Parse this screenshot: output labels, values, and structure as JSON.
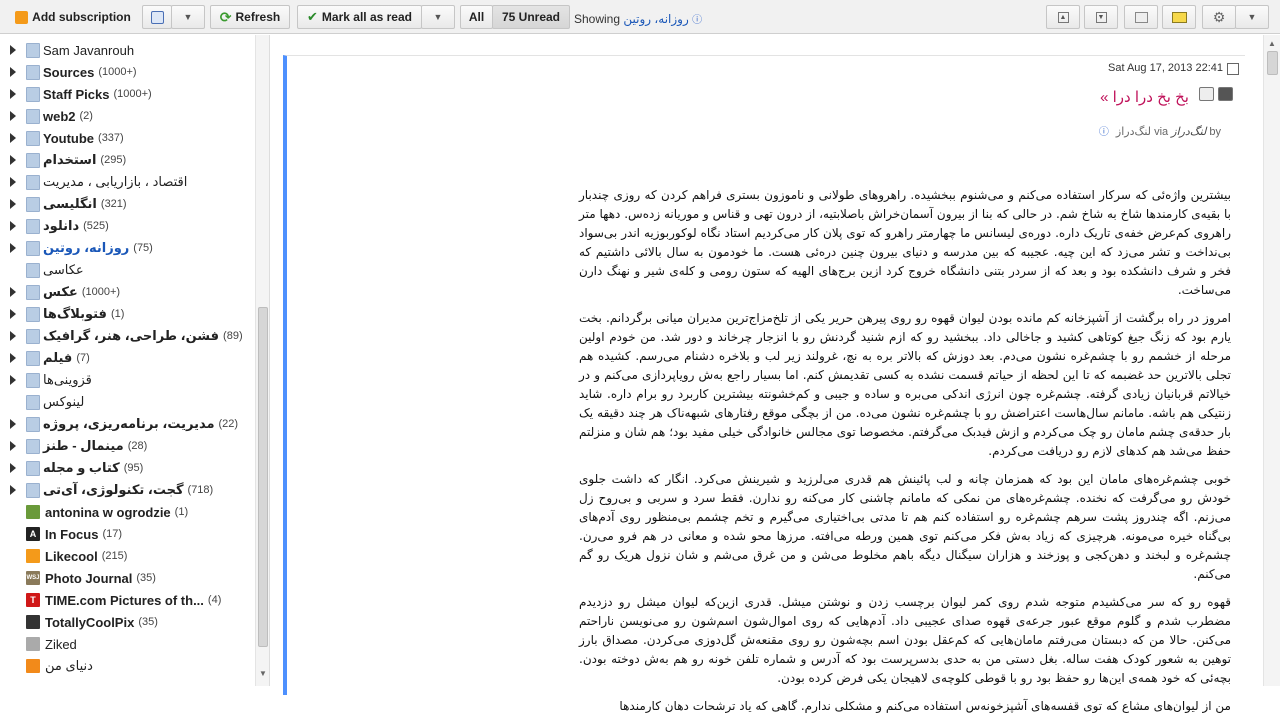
{
  "toolbar": {
    "add_subscription": "Add subscription",
    "refresh": "Refresh",
    "mark_all_read": "Mark all as read",
    "all": "All",
    "unread": "75 Unread",
    "showing": "Showing",
    "showing_feed": "روزانه، روتین",
    "colors": {
      "refresh_icon": "#3a9a2f",
      "check": "#2a8a2a",
      "rss": "#f49a1a"
    }
  },
  "sidebar": {
    "items": [
      {
        "label": "Sam Javanrouh",
        "count": "",
        "type": "folder",
        "bold": false
      },
      {
        "label": "Sources",
        "count": "(1000+)",
        "type": "folder",
        "bold": true
      },
      {
        "label": "Staff Picks",
        "count": "(1000+)",
        "type": "folder",
        "bold": true
      },
      {
        "label": "web2",
        "count": "(2)",
        "type": "folder",
        "bold": true
      },
      {
        "label": "Youtube",
        "count": "(337)",
        "type": "folder",
        "bold": true
      },
      {
        "label": "استخدام",
        "count": "(295)",
        "type": "folder",
        "bold": true
      },
      {
        "label": "اقتصاد ، بازاریابی ، مدیریت",
        "count": "",
        "type": "folder",
        "bold": false
      },
      {
        "label": "انگلیسی",
        "count": "(321)",
        "type": "folder",
        "bold": true
      },
      {
        "label": "دانلود",
        "count": "(525)",
        "type": "folder",
        "bold": true
      },
      {
        "label": "روزانه، روتین",
        "count": "(75)",
        "type": "folder",
        "bold": true,
        "selected": true
      },
      {
        "label": "عکاسی",
        "count": "",
        "type": "folder",
        "bold": false,
        "noarrow": true
      },
      {
        "label": "عکس",
        "count": "(1000+)",
        "type": "folder",
        "bold": true
      },
      {
        "label": "فتوبلاگ‌ها",
        "count": "(1)",
        "type": "folder",
        "bold": true
      },
      {
        "label": "فشن، طراحی، هنر، گرافیک",
        "count": "(89)",
        "type": "folder",
        "bold": true
      },
      {
        "label": "فیلم",
        "count": "(7)",
        "type": "folder",
        "bold": true
      },
      {
        "label": "قزوینی‌ها",
        "count": "",
        "type": "folder",
        "bold": false
      },
      {
        "label": "لینوکس",
        "count": "",
        "type": "folder",
        "bold": false,
        "noarrow": true
      },
      {
        "label": "مدیریت، برنامه‌ریزی، پروژه",
        "count": "(22)",
        "type": "folder",
        "bold": true
      },
      {
        "label": "مینمال - طنز",
        "count": "(28)",
        "type": "folder",
        "bold": true
      },
      {
        "label": "کتاب و مجله",
        "count": "(95)",
        "type": "folder",
        "bold": true
      },
      {
        "label": "گجت، تکنولوژی، آی‌تی",
        "count": "(718)",
        "type": "folder",
        "bold": true
      },
      {
        "label": "antonina w ogrodzie",
        "count": "(1)",
        "type": "feed",
        "bold": true,
        "icon_color": "#6a9a3a"
      },
      {
        "label": "In Focus",
        "count": "(17)",
        "type": "feed",
        "bold": true,
        "icon_color": "#222222",
        "icon_text": "A"
      },
      {
        "label": "Likecool",
        "count": "(215)",
        "type": "feed",
        "bold": true,
        "icon_color": "#f49a1a"
      },
      {
        "label": "Photo Journal",
        "count": "(35)",
        "type": "feed",
        "bold": true,
        "icon_color": "#8a7a5a",
        "icon_text": "WSJ"
      },
      {
        "label": "TIME.com Pictures of th...",
        "count": "(4)",
        "type": "feed",
        "bold": true,
        "icon_color": "#d01818",
        "icon_text": "T",
        "trunc": true
      },
      {
        "label": "TotallyCoolPix",
        "count": "(35)",
        "type": "feed",
        "bold": true,
        "icon_color": "#333333"
      },
      {
        "label": "Ziked",
        "count": "",
        "type": "feed",
        "bold": false,
        "icon_color": "#aaaaaa"
      },
      {
        "label": "دنیای من",
        "count": "",
        "type": "feed",
        "bold": false,
        "icon_color": "#f28a1a"
      }
    ]
  },
  "entry": {
    "date": "Sat Aug 17, 2013 22:41",
    "title": "بخ بخ درا درا »",
    "by": "by",
    "author": "لنگ‌دراز",
    "via": "via",
    "source": "لنگ‌دراز",
    "paragraphs": [
      "بیشترین واژه‌ئی که سرکار استفاده می‌کنم و می‌شنوم ببخشیده. راهروهای طولانی و ناموزون بستری فراهم کردن که روزی چندبار با بقیه‌ی کارمندها شاخ به شاخ شم. در حالی که بنا از بیرون آسمان‌خراش باصلابتیه، از درون تهی و قناس و موریانه زده‌س. دهها متر راهروی کم‌عرض خفه‌ی تاریک داره. دوره‌ی لیسانس ما چهارمتر راهرو که توی پلان کار می‌کردیم استاد نگاه لوکوربوزیه اندر بی‌سواد بی‌نداخت و تشر می‌زد که این چیه. عجیبه که بین مدرسه و دنیای بیرون چنین دره‌ئی هست. ما خودمون به سال بالائی داشتیم که فخر و شرف دانشکده بود و بعد که از سردر بتنی دانشگاه خروج کرد ازین برج‌های الهیه که ستون رومی و کله‌ی شیر و نهنگ دارن می‌ساخت.",
      "امروز در راه برگشت از آشپزخانه کم مانده بودن لیوان قهوه رو روی پیرهن حریر یکی از تلخ‌مزاج‌ترین مدیران میانی برگردانم. بخت یارم بود که زنگ جیغ کوتاهی کشید و جاخالی داد. ببخشید رو که ازم شنید گردنش رو با انزجار چرخاند و دور شد. من خودم اولین مرحله از خشمم رو با چشم‌غره نشون می‌دم. بعد دوزش که بالاتر بره به نچ، غرولند زیر لب و بلاخره دشنام می‌رسم. کشیده هم تجلی بالاترین حد غضبمه که تا این لحظه از حیاتم قسمت نشده به کسی تقدیمش کنم. اما بسیار راجع به‌ش رویاپردازی می‌کنم و در خیالاتم قربانیان زیادی گرفته. چشم‌غره چون انرژی اندکی می‌بره و ساده و جیبی و کم‌خشونته بیشترین کاربرد رو برام داره. شاید زنتیکی هم باشه. مامانم سال‌هاست اعتراضش رو با چشم‌غره نشون می‌ده. من از بچگی موقع رفتارهای شبهه‌ناک هر چند دقیقه یک بار حدقه‌ی چشم مامان رو چک می‌کردم و ازش فیدبک می‌گرفتم. مخصوصا توی مجالس خانوادگی خیلی مفید بود؛ هم شان و منزلتم حفظ می‌شد هم کدهای لازم رو دریافت می‌کردم.",
      "خوبی چشم‌غره‌های مامان این بود که همزمان چانه و لب پائینش هم قدری می‌لرزید و شیرینش می‌کرد. انگار که داشت جلوی خودش رو می‌گرفت که نخنده. چشم‌غره‌های من نمکی که مامانم چاشنی کار می‌کنه رو ندارن. فقط سرد و سربی و بی‌روح زل می‌زنم. اگه چندروز پشت سرهم چشم‌غره رو استفاده کنم هم تا مدتی بی‌اختیاری می‌گیرم و تخم چشمم بی‌منظور روی آدم‌های بی‌گناه خیره می‌مونه. هرچیزی که زیاد به‌ش فکر می‌کنم توی همین ورطه می‌افته. مرزها محو شده و معانی در هم فرو می‌رن. چشم‌غره و لبخند و دهن‌کجی و پوزخند و هزاران سیگنال دیگه باهم مخلوط می‌شن و من غرق می‌شم و شان نزول هریک رو گم می‌کنم.",
      "قهوه رو که سر می‌کشیدم متوجه شدم روی کمر لیوان برچسب زدن و نوشتن میشل. قدری ازین‌که لیوان میشل رو دزدیدم مضطرب شدم و گلوم موقع عبور جرعه‌ی قهوه صدای عجیبی داد. آدم‌هایی که روی اموال‌شون اسم‌شون رو می‌نویسن ناراحتم می‌کنن. حالا من که دبستان می‌رفتم مامان‌هایی که کم‌عقل بودن اسم بچه‌شون رو روی مقنعه‌ش گل‌دوزی می‌کردن. مصداق بارز توهین به شعور کودک هفت ساله. بغل دستی من به حدی بدسرپرست بود که آدرس و شماره تلفن خونه رو هم به‌ش دوخته بودن. بچه‌ئی که خود همه‌ی این‌ها رو حفظ بود رو با قوطی کلوچه‌ی لاهیجان یکی فرض کرده بودن.",
      "من از لیوان‌های مشاع که توی قفسه‌های آشپزخونه‌س استفاده می‌کنم و مشکلی ندارم. گاهی که یاد ترشحات دهان کارمندها"
    ]
  }
}
